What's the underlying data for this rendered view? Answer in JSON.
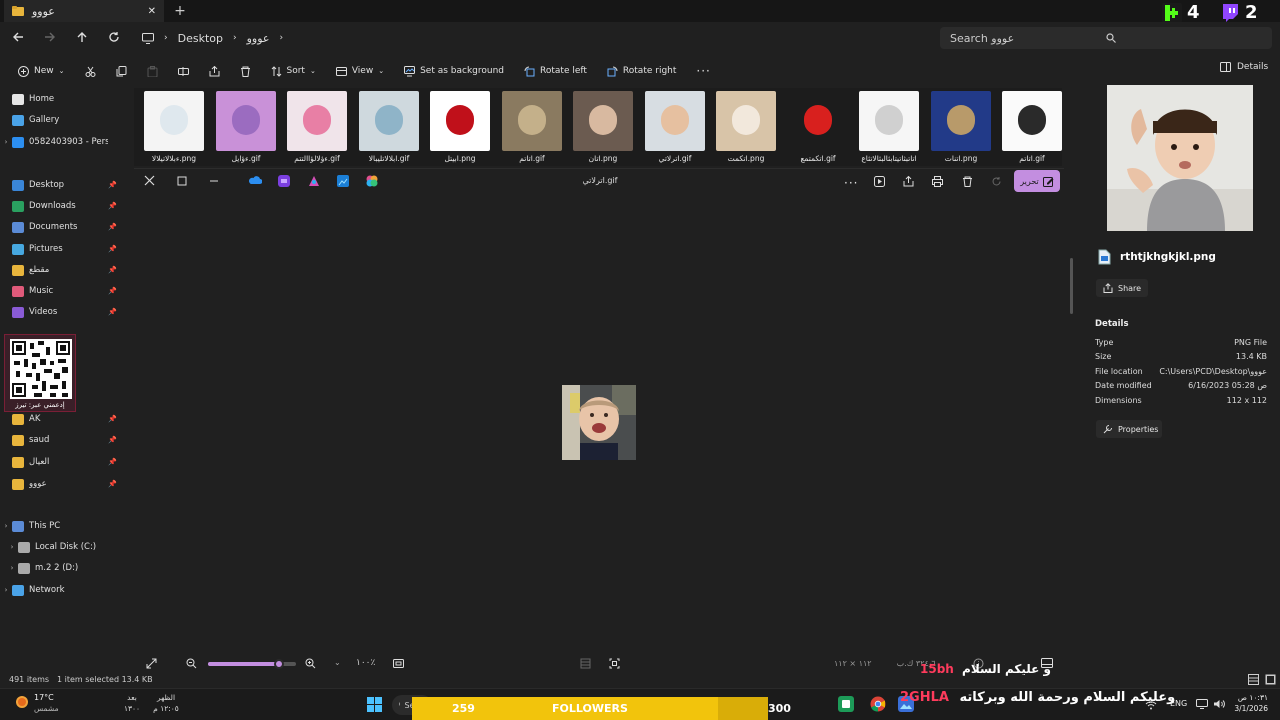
{
  "window": {
    "tab_title": "عووو",
    "close_symbol": "✕",
    "add_symbol": "+"
  },
  "overlay": {
    "counter_k": "4",
    "counter_twitch": "2",
    "followers_left": "259",
    "followers_label": "FOLLOWERS",
    "followers_right": "300",
    "followers_progress": 0.86,
    "banner_tag": "2GHLA",
    "banner_new": "15bh",
    "banner_text": "وعليكم السلام ورحمة الله وبركاته",
    "banner_text2": "و عليكم السلام",
    "qr_caption": "إدعمني عبر: تيرز"
  },
  "address": {
    "crumbs": [
      "Desktop",
      "عووو"
    ],
    "search_placeholder": "Search عووو"
  },
  "commands": {
    "new": "New",
    "sort": "Sort",
    "view": "View",
    "set_background": "Set as background",
    "rotate_left": "Rotate left",
    "rotate_right": "Rotate right",
    "details": "Details"
  },
  "sidebar": {
    "top": [
      {
        "label": "Home",
        "icon": "home-icon"
      },
      {
        "label": "Gallery",
        "icon": "gallery-icon"
      },
      {
        "label": "0582403903 - Personal",
        "icon": "onedrive-icon"
      }
    ],
    "pinned": [
      {
        "label": "Desktop",
        "color": "#3a86d8"
      },
      {
        "label": "Downloads",
        "color": "#2aa060"
      },
      {
        "label": "Documents",
        "color": "#5b8bd6"
      },
      {
        "label": "Pictures",
        "color": "#47a8e0"
      },
      {
        "label": "مقطع",
        "color": "#e8b53c"
      },
      {
        "label": "Music",
        "color": "#e05a7a"
      },
      {
        "label": "Videos",
        "color": "#8a5bd6"
      },
      {
        "label": "AK",
        "color": "#e8b53c"
      },
      {
        "label": "saud",
        "color": "#e8b53c"
      },
      {
        "label": "العيال",
        "color": "#e8b53c"
      },
      {
        "label": "عووو",
        "color": "#e8b53c"
      }
    ],
    "this_pc": "This PC",
    "drives": [
      "Local Disk (C:)",
      "m.2 2 (D:)"
    ],
    "network": "Network"
  },
  "thumbnails": [
    {
      "label": "ءبلالاتيلالا.png",
      "color": "#f4f4f4",
      "accent": "#dfe8ee"
    },
    {
      "label": "ءؤايل.gif",
      "color": "#c991d8",
      "accent": "#9b6cc0"
    },
    {
      "label": "ءؤلالؤاالتتم.gif",
      "color": "#f0e4ea",
      "accent": "#e87fa5"
    },
    {
      "label": "ابلالاتليبالا.gif",
      "color": "#cfd9de",
      "accent": "#8fb4c8"
    },
    {
      "label": "ابيتل.png",
      "color": "#ffffff",
      "accent": "#c0101a"
    },
    {
      "label": "اتاتم.gif",
      "color": "#8a7a60",
      "accent": "#c4b08a"
    },
    {
      "label": "اتان.png",
      "color": "#6b5b50",
      "accent": "#d8b9a0"
    },
    {
      "label": "اترلاتي.gif",
      "color": "#d7dde2",
      "accent": "#e6c0a0"
    },
    {
      "label": "اتكمت.png",
      "color": "#d8c4a8",
      "accent": "#f2e8dc"
    },
    {
      "label": "اتكمتمع.gif",
      "color": "#1c1c1c",
      "accent": "#d8201e"
    },
    {
      "label": "اتاتبثاتيتابثالبثالاتثاع",
      "color": "#f6f6f6",
      "accent": "#d0d0d0"
    },
    {
      "label": "اتنات.png",
      "color": "#223a88",
      "accent": "#b89a6a"
    },
    {
      "label": "اتاتم.gif",
      "color": "#fafafa",
      "accent": "#2a2a2a"
    }
  ],
  "viewer": {
    "title": "اترلاتي.gif",
    "edit_label": "تحرير",
    "zoom": "١٠٠٪",
    "dims_text": "١١٢ × ١١٢",
    "size_text": "٣٢٤٫٦ ك.ب"
  },
  "details": {
    "file_name": "rthtjkhgkjkl.png",
    "share": "Share",
    "heading": "Details",
    "rows": [
      {
        "k": "Type",
        "v": "PNG File"
      },
      {
        "k": "Size",
        "v": "13.4 KB"
      },
      {
        "k": "File location",
        "v": "C:\\Users\\PCD\\Desktop\\عووو"
      },
      {
        "k": "Date modified",
        "v": "6/16/2023 05:28 ص"
      },
      {
        "k": "Dimensions",
        "v": "112 x 112"
      }
    ],
    "properties": "Properties"
  },
  "status": {
    "items": "491 items",
    "selected": "1 item selected  13.4 KB"
  },
  "taskbar": {
    "temp": "17°C",
    "weather": "مشمس",
    "w1_top": "بعد",
    "w1_bottom": "١٣٠٠",
    "w2_top": "الظهر",
    "w2_bottom": "١٢:٠٥ م",
    "search": "Search",
    "lang": "ENG",
    "time": "١٠:٣١ ص",
    "date": "3/1/2026"
  }
}
